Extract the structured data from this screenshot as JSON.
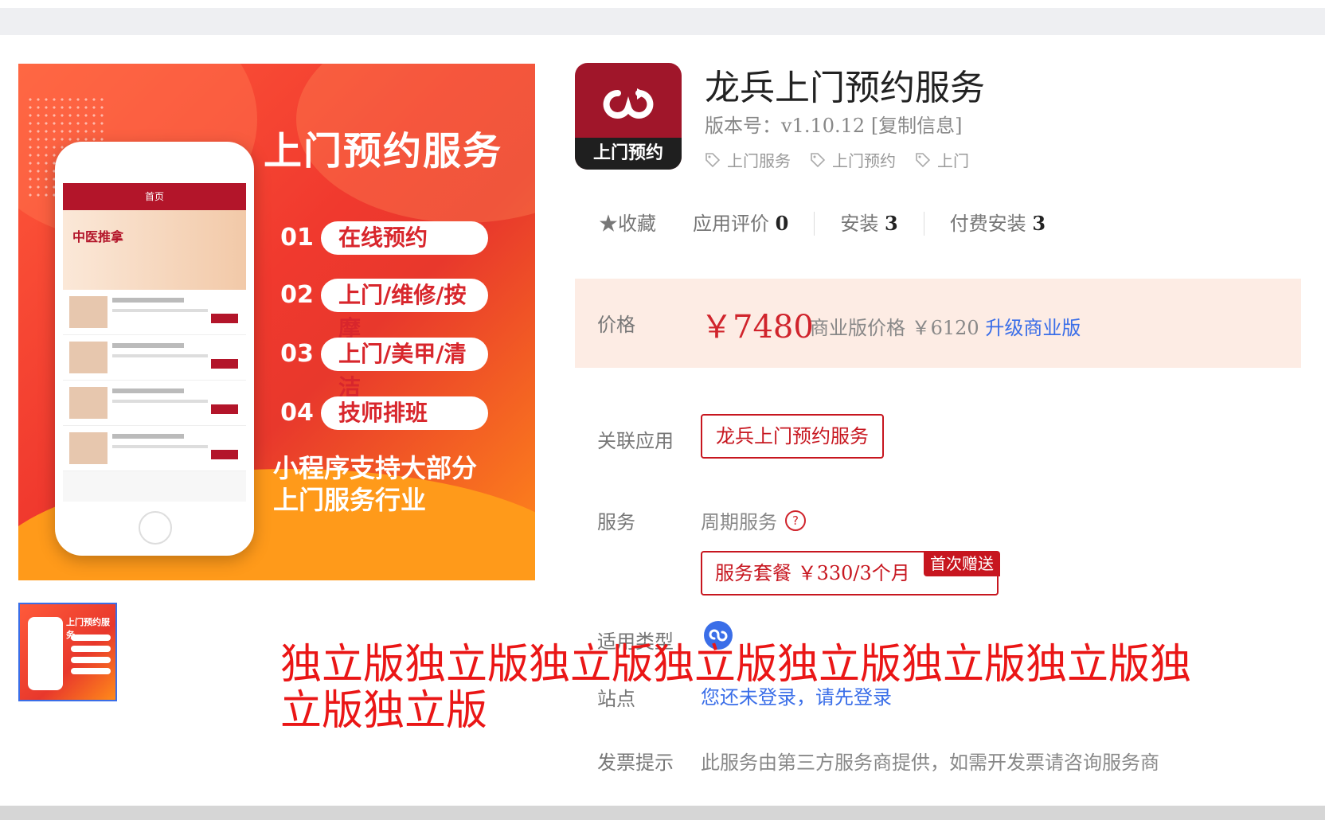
{
  "hero": {
    "title": "上门预约服务",
    "features": [
      {
        "num": "01",
        "label": "在线预约"
      },
      {
        "num": "02",
        "label": "上门/维修/按摩"
      },
      {
        "num": "03",
        "label": "上门/美甲/清洁"
      },
      {
        "num": "04",
        "label": "技师排班"
      }
    ],
    "footer_line1": "小程序支持大部分",
    "footer_line2": "上门服务行业",
    "phone_header": "首页",
    "phone_banner": "中医推拿"
  },
  "app": {
    "icon_label": "上门预约",
    "title": "龙兵上门预约服务",
    "version": "版本号：v1.10.12",
    "copy_info": "[复制信息]",
    "tags": [
      "上门服务",
      "上门预约",
      "上门"
    ]
  },
  "stats": {
    "favorite": "★收藏",
    "reviews_label": "应用评价",
    "reviews": "0",
    "installs_label": "安装",
    "installs": "3",
    "paid_installs_label": "付费安装",
    "paid_installs": "3"
  },
  "price": {
    "label": "价格",
    "main": "￥7480",
    "business_label": "商业版价格 ￥6120",
    "upgrade": "升级商业版"
  },
  "related": {
    "label": "关联应用",
    "app": "龙兵上门预约服务"
  },
  "service": {
    "label": "服务",
    "period": "周期服务",
    "help": "?",
    "package": "服务套餐  ￥330/3个月",
    "badge": "首次赠送"
  },
  "type": {
    "label": "适用类型"
  },
  "site": {
    "label": "站点",
    "text_a": "您还未登录，",
    "text_b": "请先登录"
  },
  "invoice": {
    "label": "发票提示",
    "text": "此服务由第三方服务商提供，如需开发票请咨询服务商"
  },
  "overlay": "独立版独立版独立版独立版独立版独立版独立版独立版独立版",
  "colors": {
    "accent": "#c7161f",
    "link": "#3a6ee8",
    "price_bg": "#fdece4"
  }
}
